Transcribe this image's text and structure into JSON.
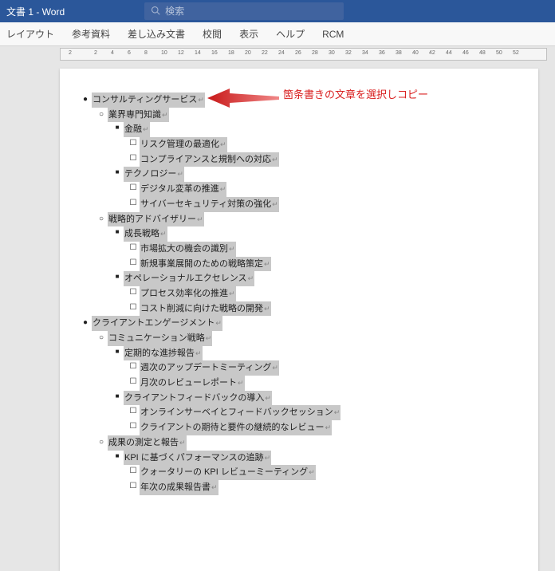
{
  "titlebar": {
    "title": "文書 1  -  Word"
  },
  "search": {
    "placeholder": "検索"
  },
  "ribbon": {
    "tabs": [
      "レイアウト",
      "参考資料",
      "差し込み文書",
      "校閲",
      "表示",
      "ヘルプ",
      "RCM"
    ]
  },
  "ruler": {
    "left_num": "2",
    "nums": [
      "2",
      "4",
      "6",
      "8",
      "10",
      "12",
      "14",
      "16",
      "18",
      "20",
      "22",
      "24",
      "26",
      "28",
      "30",
      "32",
      "34",
      "36",
      "38",
      "40",
      "42",
      "44",
      "46",
      "48",
      "50",
      "52"
    ]
  },
  "annotation": "箇条書きの文章を選択しコピー",
  "outline": [
    {
      "level": 1,
      "bullet": "disc",
      "text": "コンサルティングサービス"
    },
    {
      "level": 2,
      "bullet": "circle",
      "text": "業界専門知識"
    },
    {
      "level": 3,
      "bullet": "square",
      "text": "金融"
    },
    {
      "level": 4,
      "bullet": "box",
      "text": "リスク管理の最適化"
    },
    {
      "level": 4,
      "bullet": "box",
      "text": "コンプライアンスと規制への対応"
    },
    {
      "level": 3,
      "bullet": "square",
      "text": "テクノロジー"
    },
    {
      "level": 4,
      "bullet": "box",
      "text": "デジタル変革の推進"
    },
    {
      "level": 4,
      "bullet": "box",
      "text": "サイバーセキュリティ対策の強化"
    },
    {
      "level": 2,
      "bullet": "circle",
      "text": "戦略的アドバイザリー"
    },
    {
      "level": 3,
      "bullet": "square",
      "text": "成長戦略"
    },
    {
      "level": 4,
      "bullet": "box",
      "text": "市場拡大の機会の識別"
    },
    {
      "level": 4,
      "bullet": "box",
      "text": "新規事業展開のための戦略策定"
    },
    {
      "level": 3,
      "bullet": "square",
      "text": "オペレーショナルエクセレンス"
    },
    {
      "level": 4,
      "bullet": "box",
      "text": "プロセス効率化の推進"
    },
    {
      "level": 4,
      "bullet": "box",
      "text": "コスト削減に向けた戦略の開発"
    },
    {
      "level": 1,
      "bullet": "disc",
      "text": "クライアントエンゲージメント"
    },
    {
      "level": 2,
      "bullet": "circle",
      "text": "コミュニケーション戦略"
    },
    {
      "level": 3,
      "bullet": "square",
      "text": "定期的な進捗報告"
    },
    {
      "level": 4,
      "bullet": "box",
      "text": "週次のアップデートミーティング"
    },
    {
      "level": 4,
      "bullet": "box",
      "text": "月次のレビューレポート"
    },
    {
      "level": 3,
      "bullet": "square",
      "text": "クライアントフィードバックの導入"
    },
    {
      "level": 4,
      "bullet": "box",
      "text": "オンラインサーベイとフィードバックセッション"
    },
    {
      "level": 4,
      "bullet": "box",
      "text": "クライアントの期待と要件の継続的なレビュー"
    },
    {
      "level": 2,
      "bullet": "circle",
      "text": "成果の測定と報告"
    },
    {
      "level": 3,
      "bullet": "square",
      "text": "KPI に基づくパフォーマンスの追跡"
    },
    {
      "level": 4,
      "bullet": "box",
      "text": "クォータリーの KPI レビューミーティング"
    },
    {
      "level": 4,
      "bullet": "box",
      "text": "年次の成果報告書"
    }
  ]
}
